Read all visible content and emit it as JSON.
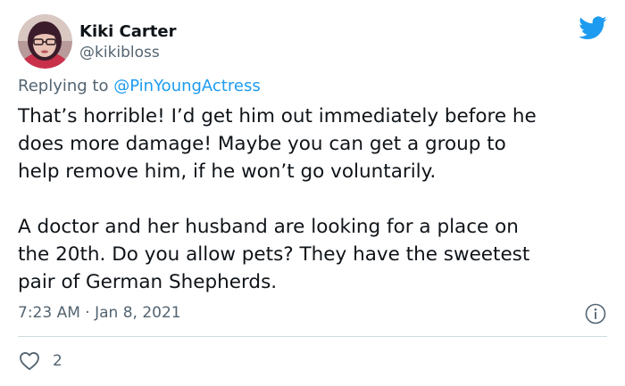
{
  "author": {
    "display_name": "Kiki Carter",
    "handle": "@kikibloss"
  },
  "reply": {
    "prefix": "Replying to ",
    "mention": "@PinYoungActress"
  },
  "body_lines": [
    "That’s horrible! I’d get him out immediately before he",
    "does more damage! Maybe you can get a group to",
    "help remove him, if he won’t go voluntarily.",
    "",
    "A doctor and her husband are looking for a place on",
    "the 20th. Do you allow pets? They have the sweetest",
    "pair of German Shepherds."
  ],
  "timestamp": "7:23 AM · Jan 8, 2021",
  "likes": {
    "count": "2"
  },
  "icons": {
    "brand": "twitter-bird-icon",
    "info": "info-icon",
    "like": "heart-icon"
  },
  "colors": {
    "brand_blue": "#1d9bf0",
    "secondary_text": "#536471",
    "divider": "#cfd9de"
  }
}
